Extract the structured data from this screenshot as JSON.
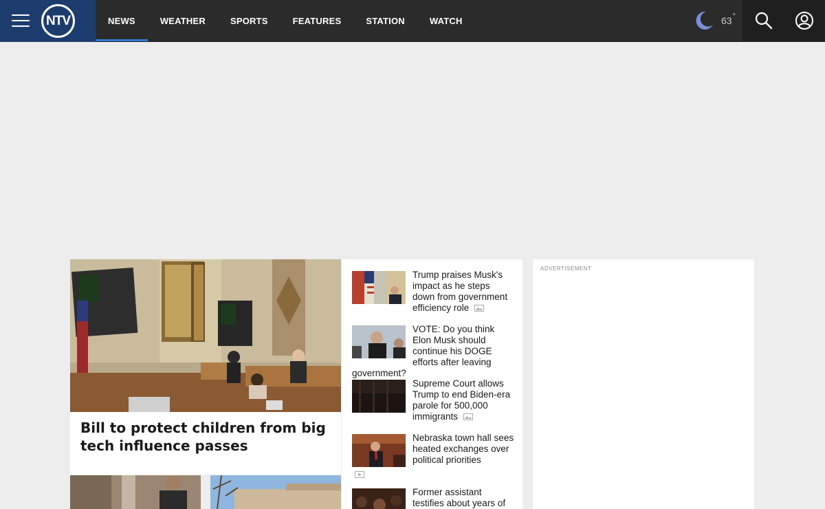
{
  "header": {
    "logo_text": "NTV",
    "nav": [
      {
        "label": "NEWS",
        "active": true
      },
      {
        "label": "WEATHER"
      },
      {
        "label": "SPORTS"
      },
      {
        "label": "FEATURES"
      },
      {
        "label": "STATION"
      },
      {
        "label": "WATCH"
      }
    ],
    "weather": {
      "temperature": "63",
      "degree_symbol": "°",
      "icon": "moon-icon"
    },
    "icons": [
      "menu-icon",
      "search-icon",
      "account-icon"
    ]
  },
  "feature": {
    "headline": "Bill to protect children from big tech influence passes"
  },
  "stories": [
    {
      "headline": "Trump praises Musk's impact as he steps down from government efficiency role",
      "media": "gallery-icon"
    },
    {
      "headline": "VOTE: Do you think Elon Musk should continue his DOGE efforts after leaving government?",
      "media": ""
    },
    {
      "headline": "Supreme Court allows Trump to end Biden-era parole for 500,000 immigrants",
      "media": "gallery-icon"
    },
    {
      "headline": "Nebraska town hall sees heated exchanges over political priorities",
      "media": "video-icon"
    },
    {
      "headline": "Former assistant testifies about years of",
      "media": ""
    }
  ],
  "ad": {
    "label": "ADVERTISEMENT"
  },
  "colors": {
    "brand": "#1d3c6e",
    "topbar": "#2b2b2b",
    "accent": "#2f7bd6",
    "moon": "#7b8fd6"
  }
}
